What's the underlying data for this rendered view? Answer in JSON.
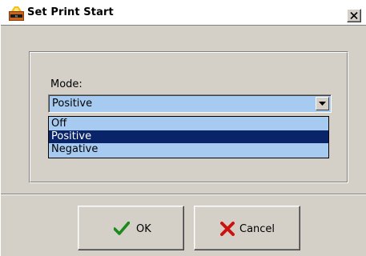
{
  "window": {
    "title": "Set Print Start",
    "app_icon": "app-logo-icon",
    "close_icon": "close-icon"
  },
  "form": {
    "mode_label": "Mode:",
    "mode_value": "Positive",
    "dropdown_arrow_icon": "chevron-down-icon",
    "options": [
      "Off",
      "Positive",
      "Negative"
    ],
    "selected_index": 1
  },
  "buttons": {
    "ok_label": "OK",
    "ok_icon": "checkmark-icon",
    "cancel_label": "Cancel",
    "cancel_icon": "x-mark-icon"
  },
  "colors": {
    "dialog_bg": "#d4d0c8",
    "combo_bg": "#a6caf0",
    "selection_bg": "#0a246a",
    "ok_icon_color": "#1a8a1a",
    "cancel_icon_color": "#cc1111"
  }
}
